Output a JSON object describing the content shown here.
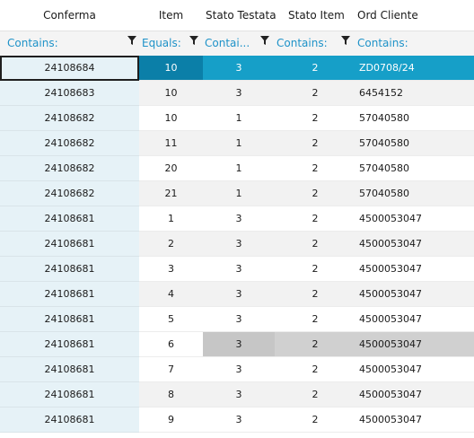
{
  "columns": [
    {
      "label": "Conferma",
      "filter": "Contains:"
    },
    {
      "label": "Item",
      "filter": "Equals:"
    },
    {
      "label": "Stato Testata",
      "filter": "Contai..."
    },
    {
      "label": "Stato Item",
      "filter": "Contains:"
    },
    {
      "label": "Ord Cliente",
      "filter": "Contains:"
    }
  ],
  "filter_icon": "funnel-icon",
  "colors": {
    "filter_text": "#1e92c8",
    "selected_row": "#169fc8",
    "selected_cell": "#0b7fa8",
    "first_column_bg": "#e6f2f7",
    "highlight_row": "#c6c6c6"
  },
  "rows": [
    {
      "conferma": "24108684",
      "item": "10",
      "stato_testata": "3",
      "stato_item": "2",
      "ord_cliente": "ZD0708/24",
      "state": "selected"
    },
    {
      "conferma": "24108683",
      "item": "10",
      "stato_testata": "3",
      "stato_item": "2",
      "ord_cliente": "6454152",
      "state": "alt"
    },
    {
      "conferma": "24108682",
      "item": "10",
      "stato_testata": "1",
      "stato_item": "2",
      "ord_cliente": "57040580",
      "state": "normal"
    },
    {
      "conferma": "24108682",
      "item": "11",
      "stato_testata": "1",
      "stato_item": "2",
      "ord_cliente": "57040580",
      "state": "alt"
    },
    {
      "conferma": "24108682",
      "item": "20",
      "stato_testata": "1",
      "stato_item": "2",
      "ord_cliente": "57040580",
      "state": "normal"
    },
    {
      "conferma": "24108682",
      "item": "21",
      "stato_testata": "1",
      "stato_item": "2",
      "ord_cliente": "57040580",
      "state": "alt"
    },
    {
      "conferma": "24108681",
      "item": "1",
      "stato_testata": "3",
      "stato_item": "2",
      "ord_cliente": "4500053047",
      "state": "normal"
    },
    {
      "conferma": "24108681",
      "item": "2",
      "stato_testata": "3",
      "stato_item": "2",
      "ord_cliente": "4500053047",
      "state": "alt"
    },
    {
      "conferma": "24108681",
      "item": "3",
      "stato_testata": "3",
      "stato_item": "2",
      "ord_cliente": "4500053047",
      "state": "normal"
    },
    {
      "conferma": "24108681",
      "item": "4",
      "stato_testata": "3",
      "stato_item": "2",
      "ord_cliente": "4500053047",
      "state": "alt"
    },
    {
      "conferma": "24108681",
      "item": "5",
      "stato_testata": "3",
      "stato_item": "2",
      "ord_cliente": "4500053047",
      "state": "normal"
    },
    {
      "conferma": "24108681",
      "item": "6",
      "stato_testata": "3",
      "stato_item": "2",
      "ord_cliente": "4500053047",
      "state": "highlight"
    },
    {
      "conferma": "24108681",
      "item": "7",
      "stato_testata": "3",
      "stato_item": "2",
      "ord_cliente": "4500053047",
      "state": "normal"
    },
    {
      "conferma": "24108681",
      "item": "8",
      "stato_testata": "3",
      "stato_item": "2",
      "ord_cliente": "4500053047",
      "state": "alt"
    },
    {
      "conferma": "24108681",
      "item": "9",
      "stato_testata": "3",
      "stato_item": "2",
      "ord_cliente": "4500053047",
      "state": "normal"
    }
  ]
}
